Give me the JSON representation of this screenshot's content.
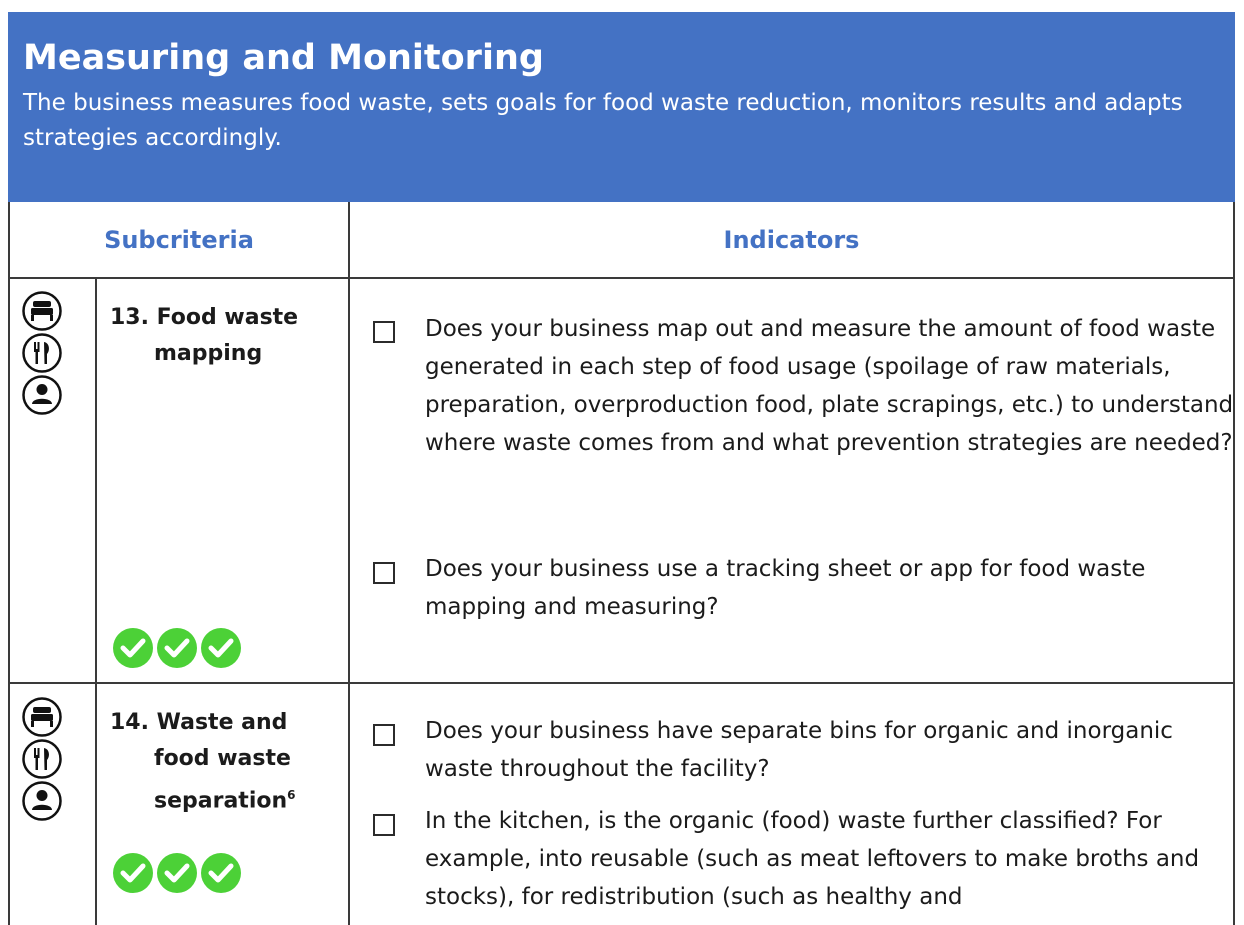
{
  "header": {
    "title": "Measuring and Monitoring",
    "description": "The business measures food waste, sets goals for food waste reduction, monitors results and adapts strategies accordingly."
  },
  "table": {
    "col_subcriteria": "Subcriteria",
    "col_indicators": "Indicators"
  },
  "rows": [
    {
      "title_line1": "13. Food waste",
      "title_line2": "mapping",
      "icons": [
        "bed-icon",
        "cutlery-icon",
        "person-icon"
      ],
      "checkmarks": 3,
      "indicators": [
        "Does your business map out and measure the amount of food waste generated in each step of food usage (spoilage of raw materials, preparation, overproduction food, plate scrapings, etc.) to understand where waste comes from and what prevention strategies are needed?",
        "Does your business use a tracking sheet or app for food waste mapping and measuring?"
      ]
    },
    {
      "title_line1": "14. Waste and",
      "title_line2": "food waste",
      "title_line3": "separation",
      "footnote": "6",
      "icons": [
        "bed-icon",
        "cutlery-icon",
        "person-icon"
      ],
      "checkmarks": 3,
      "indicators": [
        "Does your business have separate bins for organic and inorganic waste throughout the facility?",
        "In the kitchen, is the organic (food) waste further classified? For example, into reusable (such as meat leftovers to make broths and stocks), for redistribution (such as healthy and"
      ]
    }
  ],
  "colors": {
    "header_bg": "#4472c4",
    "accent_text": "#4472c4",
    "check_green": "#4cd137"
  }
}
